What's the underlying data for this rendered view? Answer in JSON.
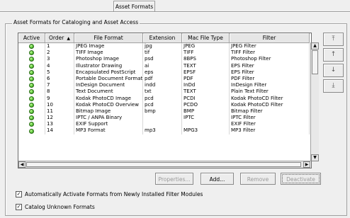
{
  "tab": {
    "label": "Asset Formats"
  },
  "group": {
    "title": "Asset Formats for Cataloging and Asset Access"
  },
  "table": {
    "columns": [
      {
        "label": "Active"
      },
      {
        "label": "Order",
        "sort": "▲"
      },
      {
        "label": "File Format"
      },
      {
        "label": "Extension"
      },
      {
        "label": "Mac File Type"
      },
      {
        "label": "Filter"
      }
    ],
    "rows": [
      {
        "order": "1",
        "format": "JPEG Image",
        "ext": "jpg",
        "mac": "JPEG",
        "filter": "JPEG Filter"
      },
      {
        "order": "2",
        "format": "TIFF Image",
        "ext": "tif",
        "mac": "TIFF",
        "filter": "TIFF Filter"
      },
      {
        "order": "3",
        "format": "Photoshop Image",
        "ext": "psd",
        "mac": "8BPS",
        "filter": "Photoshop Filter"
      },
      {
        "order": "4",
        "format": "Illustrator Drawing",
        "ext": "ai",
        "mac": "TEXT",
        "filter": "EPS Filter"
      },
      {
        "order": "5",
        "format": "Encapsulated PostScript",
        "ext": "eps",
        "mac": "EPSF",
        "filter": "EPS Filter"
      },
      {
        "order": "6",
        "format": "Portable Document Format",
        "ext": "pdf",
        "mac": "PDF",
        "filter": "PDF Filter"
      },
      {
        "order": "7",
        "format": "InDesign Document",
        "ext": "indd",
        "mac": "InDd",
        "filter": "InDesign Filter"
      },
      {
        "order": "8",
        "format": "Text Document",
        "ext": "txt",
        "mac": "TEXT",
        "filter": "Plain Text Filter"
      },
      {
        "order": "9",
        "format": "Kodak PhotoCD Image",
        "ext": "pcd",
        "mac": "PCDI",
        "filter": "Kodak PhotoCD Filter"
      },
      {
        "order": "10",
        "format": "Kodak PhotoCD Overview",
        "ext": "pcd",
        "mac": "PCDO",
        "filter": "Kodak PhotoCD Filter"
      },
      {
        "order": "11",
        "format": "Bitmap Image",
        "ext": "bmp",
        "mac": "BMP",
        "filter": "Bitmap Filter"
      },
      {
        "order": "12",
        "format": "IPTC / ANPA Binary",
        "ext": "",
        "mac": "IPTC",
        "filter": "IPTC Filter"
      },
      {
        "order": "13",
        "format": "EXIF Support",
        "ext": "",
        "mac": "",
        "filter": "EXIF Filter"
      },
      {
        "order": "14",
        "format": "MP3 Format",
        "ext": "mp3",
        "mac": "MPG3",
        "filter": "MP3 Filter"
      }
    ]
  },
  "side_buttons": [
    {
      "icon": "move-to-top-icon",
      "glyph": "⤒"
    },
    {
      "icon": "move-up-icon",
      "glyph": "↑"
    },
    {
      "icon": "move-down-icon",
      "glyph": "↓"
    },
    {
      "icon": "move-to-bottom-icon",
      "glyph": "⤓"
    }
  ],
  "buttons": {
    "properties": "Properties...",
    "add": "Add...",
    "remove": "Remove",
    "deactivate": "Deactivate"
  },
  "options": {
    "auto_activate": {
      "label": "Automatically Activate Formats from Newly Installed Filter Modules",
      "checked": true
    },
    "catalog_unknown": {
      "label": "Catalog Unknown Formats",
      "checked": true
    }
  },
  "colors": {
    "active_indicator": "#4cb82e"
  }
}
